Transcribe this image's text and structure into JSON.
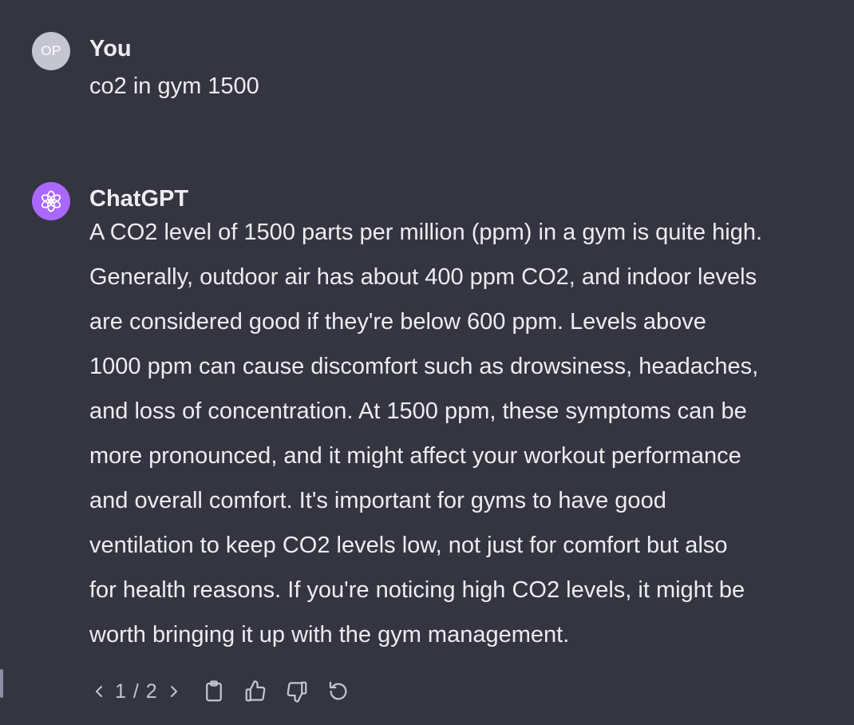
{
  "user_message": {
    "avatar_initials": "OP",
    "author": "You",
    "text": "co2 in gym 1500"
  },
  "assistant_message": {
    "author": "ChatGPT",
    "avatar_icon": "openai-logo-icon",
    "avatar_color": "#ab68ff",
    "lines": [
      "A CO2 level of 1500 parts per million (ppm) in a gym is quite high.",
      "Generally, outdoor air has about 400 ppm CO2, and indoor levels",
      "are considered good if they're below 600 ppm. Levels above",
      "1000 ppm can cause discomfort such as drowsiness, headaches,",
      "and loss of concentration. At 1500 ppm, these symptoms can be",
      "more pronounced, and it might affect your workout performance",
      "and overall comfort. It's important for gyms to have good",
      "ventilation to keep CO2 levels low, not just for comfort but also",
      "for health reasons. If you're noticing high CO2 levels, it might be",
      "worth bringing it up with the gym management."
    ]
  },
  "toolbar": {
    "pager_label": "1 / 2",
    "icons": [
      "chevron-left-icon",
      "chevron-right-icon",
      "clipboard-icon",
      "thumbs-up-icon",
      "thumbs-down-icon",
      "regenerate-icon"
    ]
  },
  "colors": {
    "background": "#343541",
    "text": "#ececf1",
    "muted": "#c5c5d2"
  }
}
